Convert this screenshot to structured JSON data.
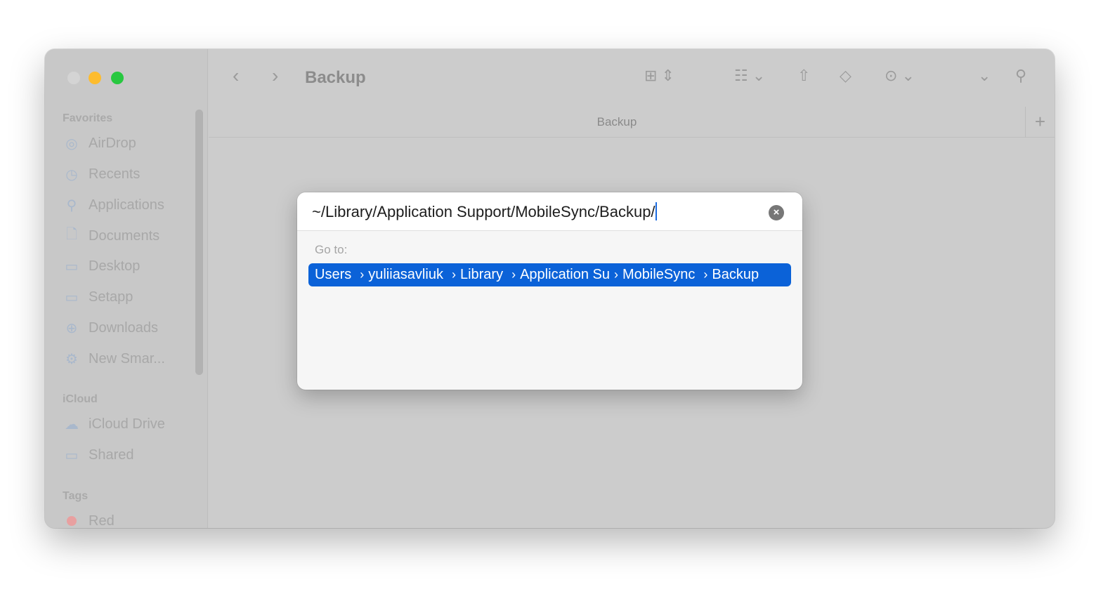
{
  "window": {
    "title": "Backup",
    "path_label": "Backup",
    "lights": {
      "close": "#d4d4d4",
      "minimize": "#fdbc2e",
      "zoom": "#28c840"
    }
  },
  "sidebar": {
    "favorites_label": "Favorites",
    "favorites": [
      {
        "label": "AirDrop",
        "icon": "airdrop-icon"
      },
      {
        "label": "Recents",
        "icon": "clock-icon"
      },
      {
        "label": "Applications",
        "icon": "applications-icon"
      },
      {
        "label": "Documents",
        "icon": "document-icon"
      },
      {
        "label": "Desktop",
        "icon": "desktop-icon"
      },
      {
        "label": "Setapp",
        "icon": "folder-icon"
      },
      {
        "label": "Downloads",
        "icon": "download-icon"
      },
      {
        "label": "New Smar...",
        "icon": "gear-icon"
      }
    ],
    "icloud_label": "iCloud",
    "icloud": [
      {
        "label": "iCloud Drive",
        "icon": "cloud-icon"
      },
      {
        "label": "Shared",
        "icon": "shared-folder-icon"
      }
    ],
    "tags_label": "Tags",
    "tags": [
      {
        "label": "Red",
        "color": "#e8a0a0"
      }
    ]
  },
  "dialog": {
    "input_value": "~/Library/Application Support/MobileSync/Backup/",
    "goto_label": "Go to:",
    "suggestion": [
      "Users",
      "yuliiasavliuk",
      "Library",
      "Application Su",
      "MobileSync",
      "Backup"
    ],
    "accent": "#0b62d8"
  }
}
